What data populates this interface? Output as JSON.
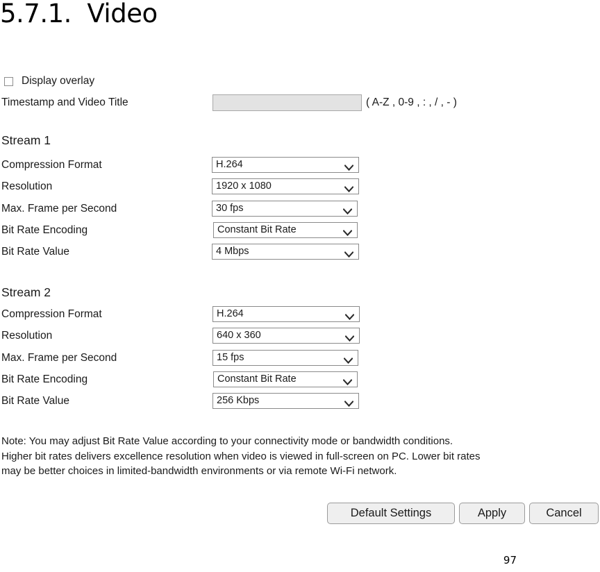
{
  "title": "5.7.1.  Video",
  "overlay": {
    "checkbox_label": "Display overlay",
    "checked": false
  },
  "timestamp": {
    "label": "Timestamp and Video Title",
    "value": "",
    "placeholder": "",
    "hint": "( A-Z , 0-9 , : , / , - )"
  },
  "streams": [
    {
      "heading": "Stream 1",
      "rows": [
        {
          "label": "Compression Format",
          "value": "H.264"
        },
        {
          "label": "Resolution",
          "value": "1920 x 1080"
        },
        {
          "label": "Max. Frame per Second",
          "value": "30 fps"
        },
        {
          "label": "Bit Rate Encoding",
          "value": "Constant Bit Rate"
        },
        {
          "label": "Bit Rate Value",
          "value": "4 Mbps"
        }
      ]
    },
    {
      "heading": "Stream 2",
      "rows": [
        {
          "label": "Compression Format",
          "value": "H.264"
        },
        {
          "label": "Resolution",
          "value": "640 x 360"
        },
        {
          "label": "Max. Frame per Second",
          "value": "15 fps"
        },
        {
          "label": "Bit Rate Encoding",
          "value": "Constant Bit Rate"
        },
        {
          "label": "Bit Rate Value",
          "value": "256 Kbps"
        }
      ]
    }
  ],
  "note": "Note: You may adjust Bit Rate Value according to your connectivity mode or bandwidth conditions.\nHigher bit rates delivers excellence resolution when video is viewed in full-screen on PC. Lower bit rates\nmay be better choices in limited-bandwidth environments or via remote Wi-Fi network.",
  "buttons": {
    "default_settings": "Default Settings",
    "apply": "Apply",
    "cancel": "Cancel"
  },
  "page_number": "97",
  "colors": {
    "text": "#1a1a1a",
    "field_border": "#8a8a8a",
    "disabled_field_bg": "#e3e3e3",
    "button_bg": "#efefef"
  }
}
